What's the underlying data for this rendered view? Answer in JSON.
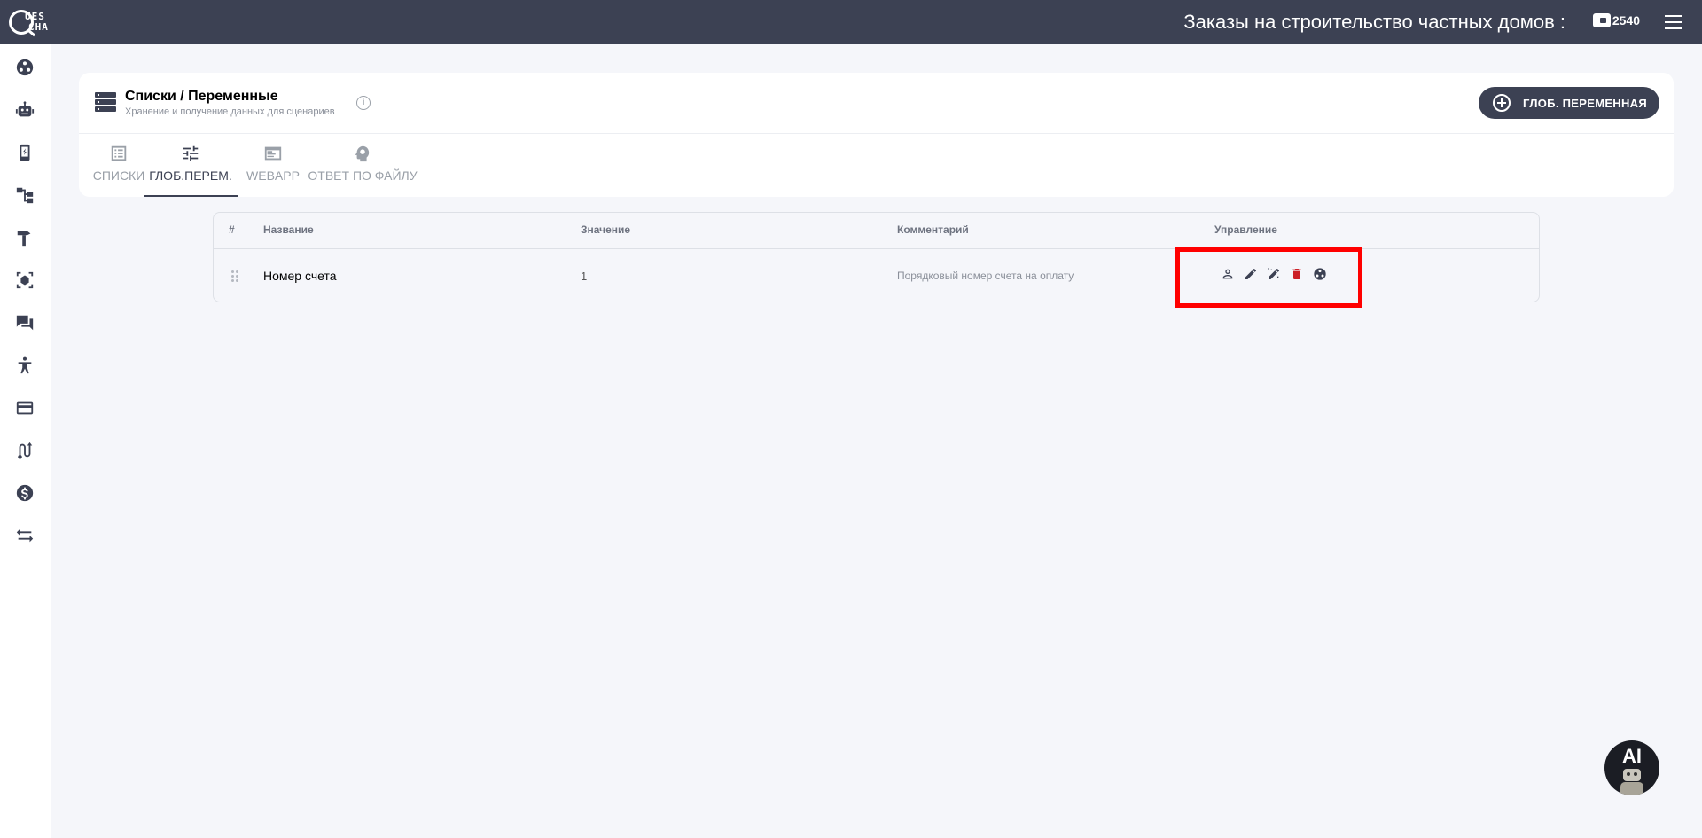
{
  "header": {
    "logo_top": "UES",
    "logo_bottom": "CHA",
    "title": "Заказы на строительство частных домов :",
    "balance": "2540"
  },
  "sidebar": {
    "items": [
      {
        "icon": "hub-icon"
      },
      {
        "icon": "robot-icon"
      },
      {
        "icon": "phone-icon"
      },
      {
        "icon": "flow-icon"
      },
      {
        "icon": "hammer-icon"
      },
      {
        "icon": "cube-icon"
      },
      {
        "icon": "chat-icon"
      },
      {
        "icon": "accessibility-icon"
      },
      {
        "icon": "card-icon"
      },
      {
        "icon": "route-icon"
      },
      {
        "icon": "dollar-icon"
      },
      {
        "icon": "swap-icon"
      }
    ]
  },
  "card": {
    "title": "Списки / Переменные",
    "subtitle": "Хранение и получение данных для сценариев",
    "info": "i",
    "add_button": "ГЛОБ. ПЕРЕМЕННАЯ",
    "tabs": [
      {
        "label": "СПИСКИ",
        "icon": "list-icon",
        "active": false
      },
      {
        "label": "ГЛОБ.ПЕРЕМ.",
        "icon": "tune-icon",
        "active": true
      },
      {
        "label": "WEBAPP",
        "icon": "webapp-icon",
        "active": false
      },
      {
        "label": "ОТВЕТ ПО ФАЙЛУ",
        "icon": "head-bulb-icon",
        "active": false
      }
    ]
  },
  "table": {
    "columns": [
      "#",
      "Название",
      "Значение",
      "Комментарий",
      "Управление"
    ],
    "rows": [
      {
        "name": "Номер счета",
        "value": "1",
        "comment": "Порядковый номер счета на оплату"
      }
    ],
    "actions": [
      "person-icon",
      "edit-icon",
      "magic-edit-icon",
      "delete-icon",
      "hub-icon"
    ]
  },
  "ai_button": {
    "label": "AI"
  },
  "colors": {
    "topbar": "#3c4153",
    "accent": "#3c4153",
    "delete": "#cc1f26",
    "highlight": "#ff0000"
  }
}
